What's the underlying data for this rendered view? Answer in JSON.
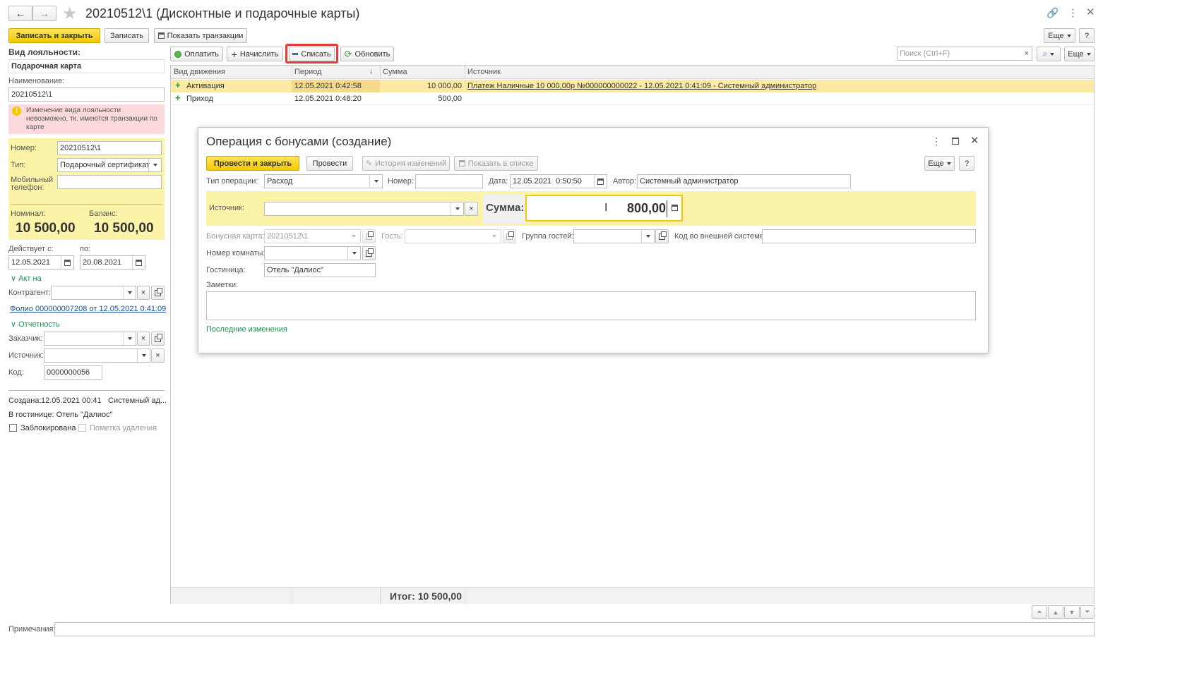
{
  "window": {
    "title": "20210512\\1 (Дисконтные и подарочные карты)"
  },
  "toolbar": {
    "save_close": "Записать и закрыть",
    "save": "Записать",
    "show_transactions": "Показать транзакции",
    "more": "Еще",
    "help": "?"
  },
  "left": {
    "loyalty_label": "Вид лояльности:",
    "loyalty_value": "Подарочная карта",
    "name_label": "Наименование:",
    "name_value": "20210512\\1",
    "warning": "Изменение вида лояльности невозможно, тк. имеются транзакции по карте",
    "number_label": "Номер:",
    "number_value": "20210512\\1",
    "type_label": "Тип:",
    "type_value": "Подарочный сертификат",
    "phone_label": "Мобильный телефон:",
    "phone_value": "",
    "nominal_label": "Номинал:",
    "nominal_value": "10 500,00",
    "balance_label": "Баланс:",
    "balance_value": "10 500,00",
    "valid_from_label": "Действует с:",
    "valid_from": "12.05.2021",
    "valid_to_label": "по:",
    "valid_to": "20.08.2021",
    "act_label": "Акт на",
    "counterparty_label": "Контрагент:",
    "folio_link": "Фолио 000000007208 от 12.05.2021 0:41:09",
    "reporting_label": "Отчетность",
    "customer_label": "Заказчик:",
    "source_label": "Источник:",
    "code_label": "Код:",
    "code_value": "0000000056",
    "created_label": "Создана:",
    "created_value": "12.05.2021 00:41",
    "created_by": "Системный ад...",
    "hotel_line": "В гостинице: Отель \"Далиос\"",
    "blocked_label": "Заблокирована",
    "deletion_label": "Пометка удаления"
  },
  "actions": {
    "pay": "Оплатить",
    "accrue": "Начислить",
    "write_off": "Списать",
    "refresh": "Обновить",
    "search_placeholder": "Поиск (Ctrl+F)",
    "more": "Еще"
  },
  "table": {
    "headers": [
      "Вид движения",
      "Период",
      "Сумма",
      "Источник"
    ],
    "rows": [
      {
        "type": "Активация",
        "period": "12.05.2021 0:42:58",
        "sum": "10 000,00",
        "source": "Платеж Наличные 10 000,00р №000000000022 - 12.05.2021 0:41:09 - Системный администратор"
      },
      {
        "type": "Приход",
        "period": "12.05.2021 0:48:20",
        "sum": "500,00",
        "source": ""
      }
    ],
    "total": "Итог: 10 500,00"
  },
  "dialog": {
    "title": "Операция с бонусами (создание)",
    "post_close": "Провести и закрыть",
    "post": "Провести",
    "history": "История изменений",
    "show_in_list": "Показать в списке",
    "more": "Еще",
    "help": "?",
    "op_type_label": "Тип операции:",
    "op_type_value": "Расход",
    "number_label": "Номер:",
    "number_value": "",
    "date_label": "Дата:",
    "date_value": "12.05.2021  0:50:50",
    "author_label": "Автор:",
    "author_value": "Системный администратор",
    "source_label": "Источник:",
    "source_value": "",
    "sum_label": "Сумма:",
    "sum_value": "800,00",
    "bonus_card_label": "Бонусная карта:",
    "bonus_card_value": "20210512\\1",
    "guest_label": "Гость:",
    "guest_value": "",
    "guest_group_label": "Группа гостей:",
    "guest_group_value": "",
    "ext_code_label": "Код во внешней системе:",
    "ext_code_value": "",
    "room_label": "Номер комнаты:",
    "room_value": "",
    "hotel_label": "Гостиница:",
    "hotel_value": "Отель \"Далиос\"",
    "notes_label": "Заметки:",
    "notes_value": "",
    "last_changes": "Последние изменения"
  },
  "bottom": {
    "notes_label": "Примечания:",
    "notes_value": ""
  },
  "colors": {
    "accent_yellow": "#f5c800",
    "highlight_yellow": "#fbf3a8",
    "red_frame": "#e23b3b",
    "warning_pink": "#fbd9dc",
    "link_green": "#1e8f4e"
  }
}
